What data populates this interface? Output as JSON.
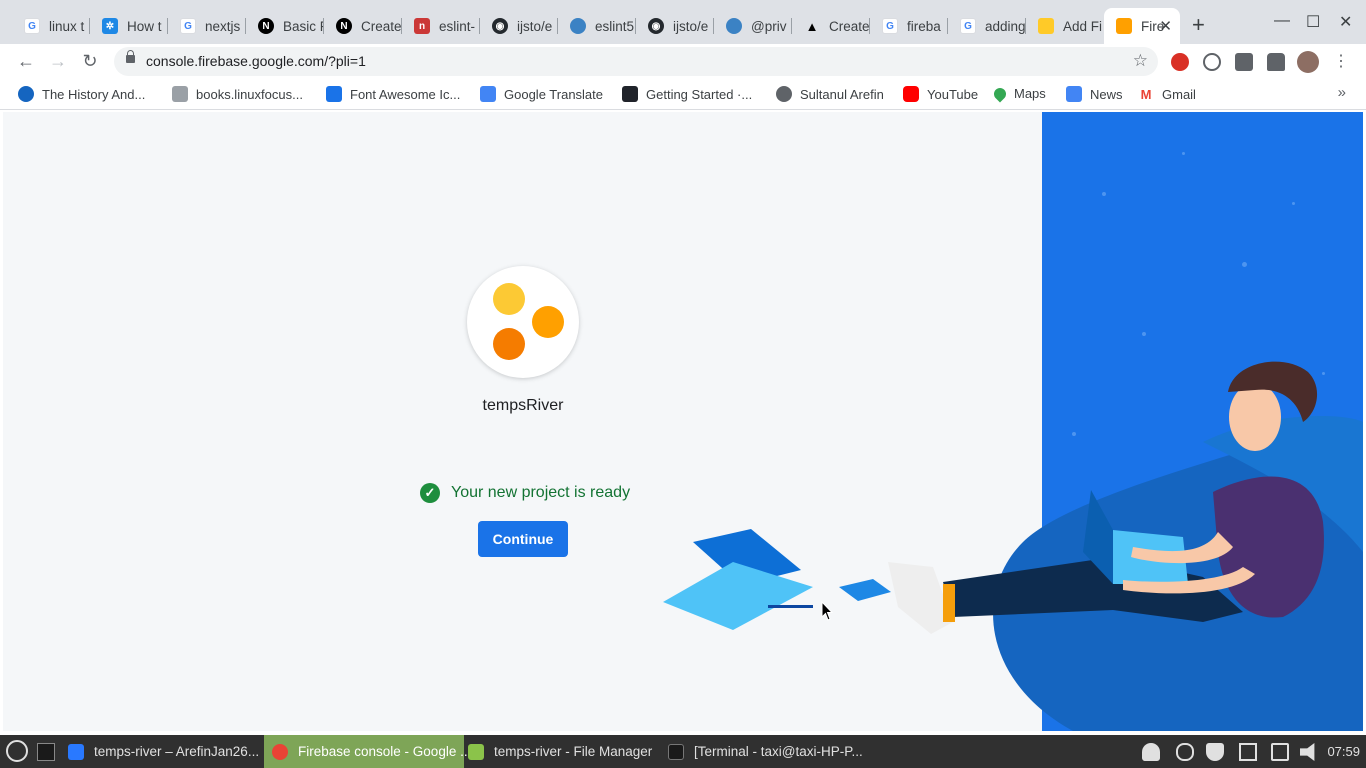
{
  "browser": {
    "tabs": [
      {
        "label": "linux t",
        "favicon": "google-icon"
      },
      {
        "label": "How t",
        "favicon": "gear-snowflake-icon"
      },
      {
        "label": "nextjs",
        "favicon": "google-icon"
      },
      {
        "label": "Basic F",
        "favicon": "nextjs-icon"
      },
      {
        "label": "Create",
        "favicon": "nextjs-icon"
      },
      {
        "label": "eslint-",
        "favicon": "npm-icon"
      },
      {
        "label": "ijsto/e",
        "favicon": "github-icon"
      },
      {
        "label": "eslint5",
        "favicon": "user-icon"
      },
      {
        "label": "ijsto/e",
        "favicon": "github-icon"
      },
      {
        "label": "@priv",
        "favicon": "user-icon"
      },
      {
        "label": "Create",
        "favicon": "vercel-icon"
      },
      {
        "label": "fireba",
        "favicon": "google-icon"
      },
      {
        "label": "adding",
        "favicon": "google-icon"
      },
      {
        "label": "Add Fi",
        "favicon": "firebase-icon"
      },
      {
        "label": "Fire",
        "favicon": "firebase-icon",
        "active": true
      }
    ],
    "url": "console.firebase.google.com/?pli=1",
    "bookmarks": [
      {
        "label": "The History And...",
        "color": "#1565c0"
      },
      {
        "label": "books.linuxfocus...",
        "color": "#9aa0a6"
      },
      {
        "label": "Font Awesome Ic...",
        "color": "#1a73e8"
      },
      {
        "label": "Google Translate",
        "color": "#4285f4"
      },
      {
        "label": "Getting Started ·...",
        "color": "#20232a"
      },
      {
        "label": "Sultanul Arefin",
        "color": "#5f6368"
      },
      {
        "label": "YouTube",
        "color": "#ff0000"
      },
      {
        "label": "Maps",
        "color": "#34a853"
      },
      {
        "label": "News",
        "color": "#4285f4"
      },
      {
        "label": "Gmail",
        "color": "#ea4335"
      }
    ]
  },
  "page": {
    "project_name": "tempsRiver",
    "status_message": "Your new project is ready",
    "continue_label": "Continue",
    "accent": "#1a73e8",
    "success_color": "#137333"
  },
  "taskbar": {
    "items": [
      {
        "label": "temps-river – ArefinJan26...",
        "icon": "webstorm-icon"
      },
      {
        "label": "Firebase console - Google ...",
        "icon": "chrome-icon",
        "active": true
      },
      {
        "label": "temps-river - File Manager",
        "icon": "folder-icon"
      },
      {
        "label": "[Terminal - taxi@taxi-HP-P...",
        "icon": "terminal-icon"
      }
    ],
    "clock": "07:59"
  }
}
